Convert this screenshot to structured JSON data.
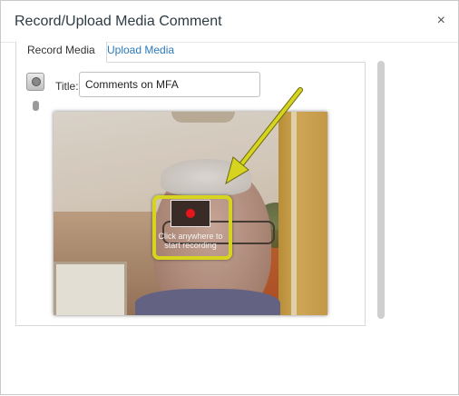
{
  "dialog": {
    "title": "Record/Upload Media Comment",
    "close_label": "×"
  },
  "tabs": [
    {
      "label": "Record Media",
      "active": true
    },
    {
      "label": "Upload Media",
      "active": false
    }
  ],
  "form": {
    "title_label": "Title:",
    "title_value": "Comments on MFA"
  },
  "recorder": {
    "caption": "Click anywhere to start recording"
  },
  "icons": {
    "webcam": "webcam-icon",
    "microphone": "microphone-icon",
    "record": "record-icon",
    "arrow": "annotation-arrow"
  },
  "colors": {
    "highlight": "#d7d41f",
    "record_dot": "#e8151b",
    "tab_link": "#2b7abc"
  }
}
